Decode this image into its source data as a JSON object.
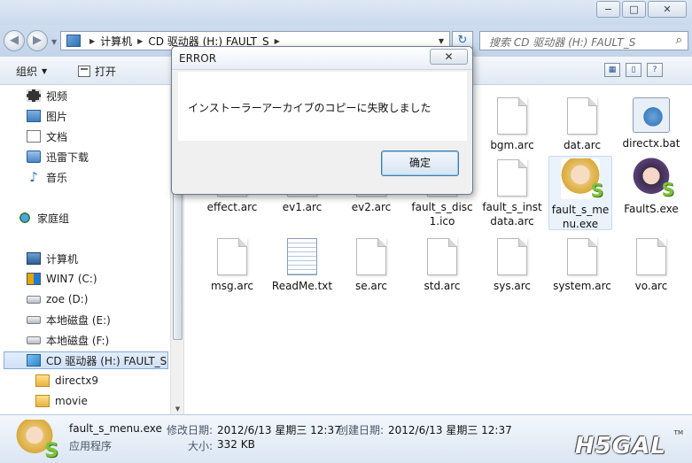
{
  "titlebar": {
    "buttons": [
      "−",
      "□",
      "✕"
    ]
  },
  "address": {
    "crumbs": [
      "计算机",
      "CD 驱动器 (H:) FAULT_S"
    ],
    "search_placeholder": "搜索 CD 驱动器 (H:) FAULT_S"
  },
  "toolbar": {
    "organize": "组织",
    "open": "打开"
  },
  "nav": {
    "library": [
      {
        "label": "视频",
        "icon": "video-icon"
      },
      {
        "label": "图片",
        "icon": "picture-icon"
      },
      {
        "label": "文档",
        "icon": "document-icon"
      },
      {
        "label": "迅雷下载",
        "icon": "download-icon"
      },
      {
        "label": "音乐",
        "icon": "music-icon"
      }
    ],
    "homegroup": "家庭组",
    "computer": "计算机",
    "drives": [
      {
        "label": "WIN7 (C:)"
      },
      {
        "label": "zoe (D:)"
      },
      {
        "label": "本地磁盘 (E:)"
      },
      {
        "label": "本地磁盘 (F:)"
      },
      {
        "label": "CD 驱动器 (H:) FAULT_S"
      }
    ],
    "folders": [
      "directx9",
      "movie"
    ]
  },
  "files": [
    {
      "name": "bgm.arc",
      "type": "page"
    },
    {
      "name": "dat.arc",
      "type": "page"
    },
    {
      "name": "directx.bat",
      "type": "bat"
    },
    {
      "name": "effect.arc",
      "type": "page"
    },
    {
      "name": "ev1.arc",
      "type": "page"
    },
    {
      "name": "ev2.arc",
      "type": "page"
    },
    {
      "name": "fault_s_disc1.ico",
      "type": "page"
    },
    {
      "name": "fault_s_instdata.arc",
      "type": "page"
    },
    {
      "name": "fault_s_menu.exe",
      "type": "anime"
    },
    {
      "name": "FaultS.exe",
      "type": "anime2"
    },
    {
      "name": "msg.arc",
      "type": "page"
    },
    {
      "name": "ReadMe.txt",
      "type": "txt"
    },
    {
      "name": "se.arc",
      "type": "page"
    },
    {
      "name": "std.arc",
      "type": "page"
    },
    {
      "name": "sys.arc",
      "type": "page"
    },
    {
      "name": "system.arc",
      "type": "page"
    },
    {
      "name": "vo.arc",
      "type": "page"
    }
  ],
  "dialog": {
    "title": "ERROR",
    "close": "✕",
    "message": "インストーラーアーカイブのコピーに失敗しました",
    "ok": "确定"
  },
  "details": {
    "filename": "fault_s_menu.exe",
    "type": "应用程序",
    "modified_label": "修改日期:",
    "modified": "2012/6/13 星期三 12:37",
    "created_label": "创建日期:",
    "created": "2012/6/13 星期三 12:37",
    "size_label": "大小:",
    "size": "332 KB",
    "watermark": "H5GAL",
    "watermark_tm": "TM"
  }
}
